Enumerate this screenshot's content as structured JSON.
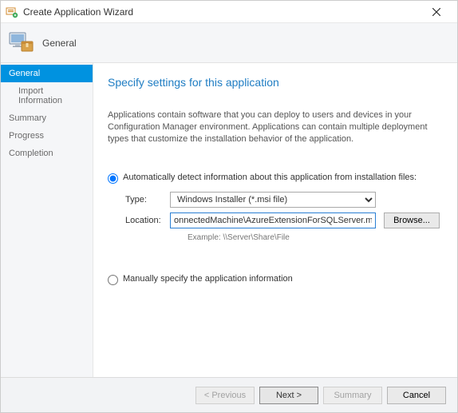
{
  "window": {
    "title": "Create Application Wizard"
  },
  "banner": {
    "label": "General"
  },
  "sidebar": {
    "items": [
      {
        "label": "General",
        "active": true,
        "sub": false
      },
      {
        "label": "Import Information",
        "active": false,
        "sub": true
      },
      {
        "label": "Summary",
        "active": false,
        "sub": false
      },
      {
        "label": "Progress",
        "active": false,
        "sub": false
      },
      {
        "label": "Completion",
        "active": false,
        "sub": false
      }
    ]
  },
  "main": {
    "heading": "Specify settings for this application",
    "description": "Applications contain software that you can deploy to users and devices in your Configuration Manager environment. Applications can contain multiple deployment types that customize the installation behavior of the application.",
    "option_auto": "Automatically detect information about this application from installation files:",
    "option_manual": "Manually specify the application information",
    "type_label": "Type:",
    "type_value": "Windows Installer (*.msi file)",
    "location_label": "Location:",
    "location_value": "onnectedMachine\\AzureExtensionForSQLServer.msi",
    "example_label": "Example: \\\\Server\\Share\\File",
    "browse_label": "Browse..."
  },
  "footer": {
    "previous": "< Previous",
    "next": "Next >",
    "summary": "Summary",
    "cancel": "Cancel"
  },
  "icons": {
    "app": "wizard-icon",
    "banner": "computer-box-icon",
    "close": "close-icon"
  }
}
